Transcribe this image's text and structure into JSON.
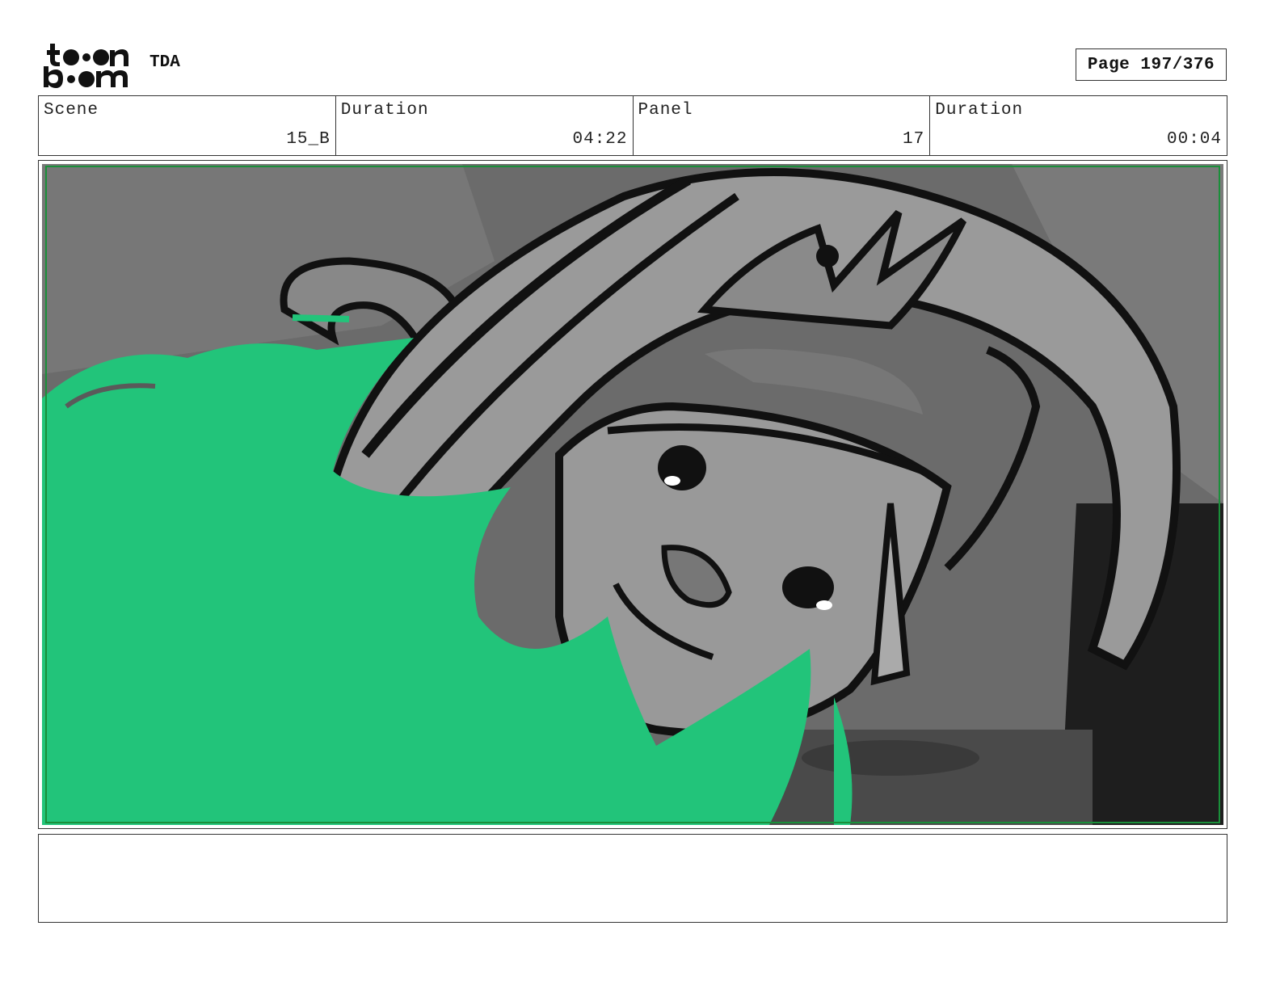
{
  "header": {
    "project_name": "TDA",
    "page_label": "Page 197/376"
  },
  "fields": [
    {
      "label": "Scene",
      "value": "15_B"
    },
    {
      "label": "Duration",
      "value": "04:22"
    },
    {
      "label": "Panel",
      "value": "17"
    },
    {
      "label": "Duration",
      "value": "00:04"
    }
  ],
  "panel": {
    "image": "storyboard-drawing-character-face-with-green-flames",
    "safe_frame_color": "#1a8f3a",
    "flame_color": "#22c47a"
  },
  "notes": {
    "text": ""
  }
}
